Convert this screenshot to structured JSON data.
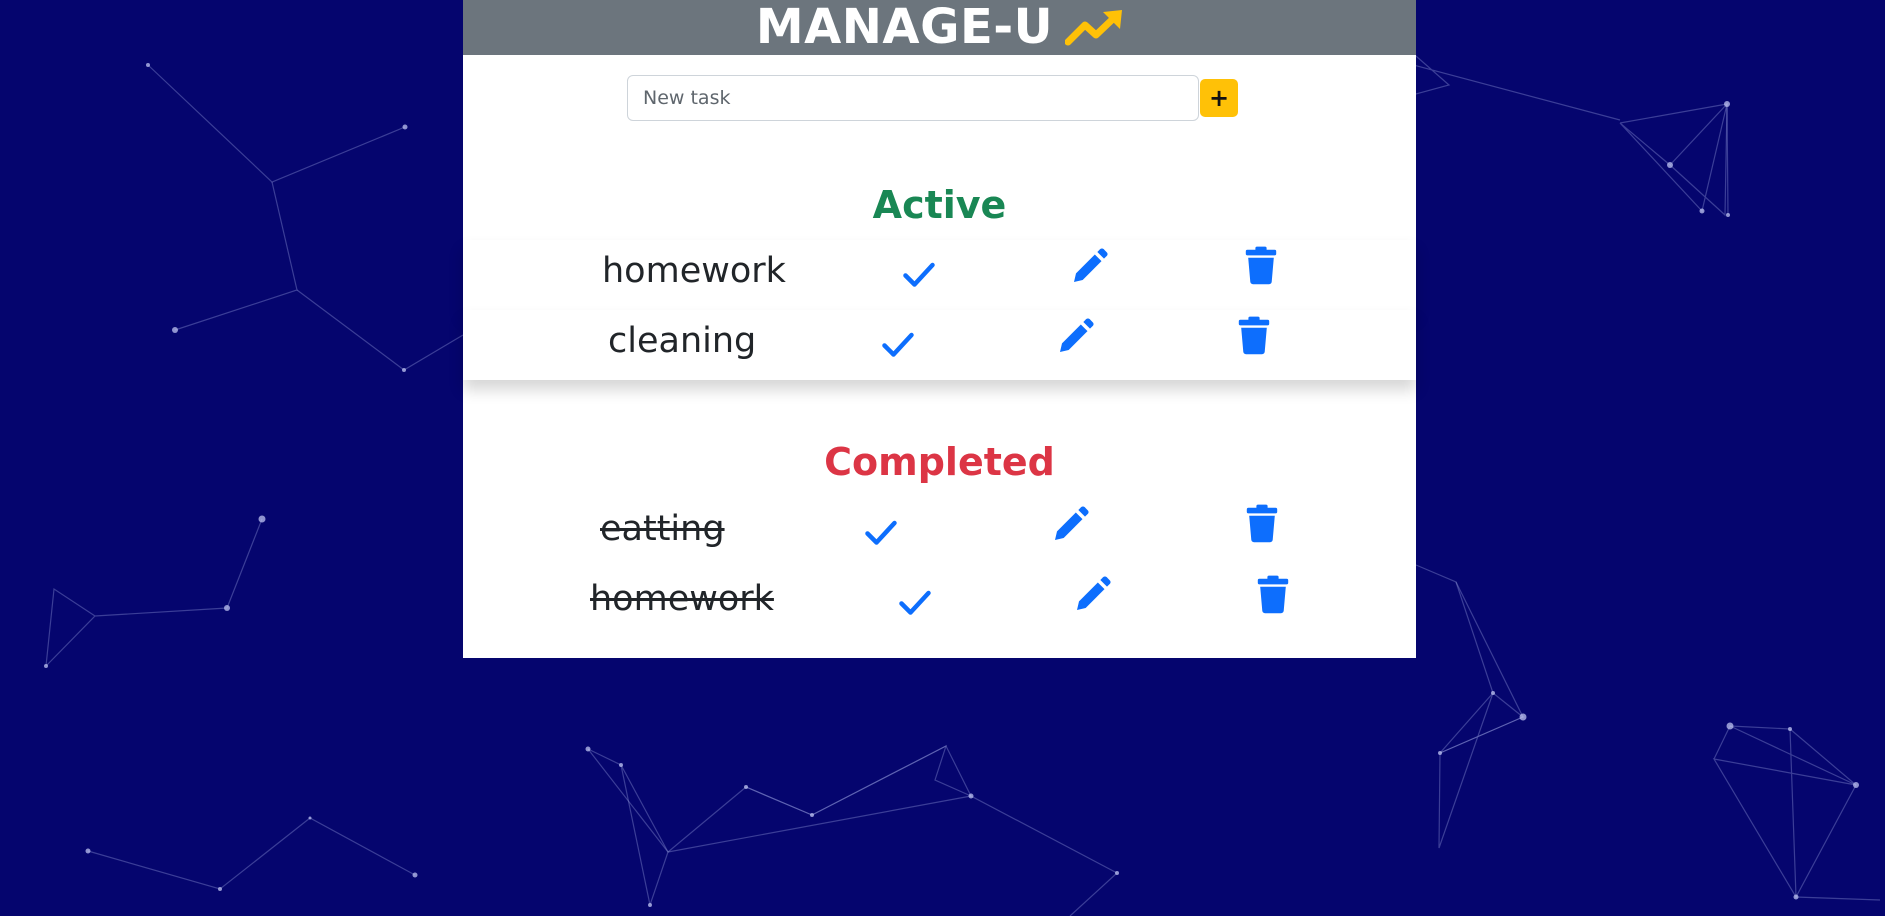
{
  "app": {
    "title": "MANAGE-U",
    "trend_icon": "trending-up-icon",
    "accent_color": "#ffc107",
    "header_color": "#6c757d",
    "background_color": "#05056e"
  },
  "add_task": {
    "placeholder": "New task",
    "value": "",
    "button_label": "+"
  },
  "sections": {
    "active_title": "Active",
    "completed_title": "Completed",
    "active_color": "#198754",
    "completed_color": "#dc3545"
  },
  "active_tasks": [
    {
      "text": "homework",
      "icons": [
        "check-icon",
        "pencil-icon",
        "trash-icon"
      ]
    },
    {
      "text": "cleaning",
      "icons": [
        "check-icon",
        "pencil-icon",
        "trash-icon"
      ]
    }
  ],
  "completed_tasks": [
    {
      "text": "eatting",
      "icons": [
        "check-icon",
        "pencil-icon",
        "trash-icon"
      ]
    },
    {
      "text": "homework",
      "icons": [
        "check-icon",
        "pencil-icon",
        "trash-icon"
      ]
    }
  ],
  "icon_color": "#0d6efd"
}
